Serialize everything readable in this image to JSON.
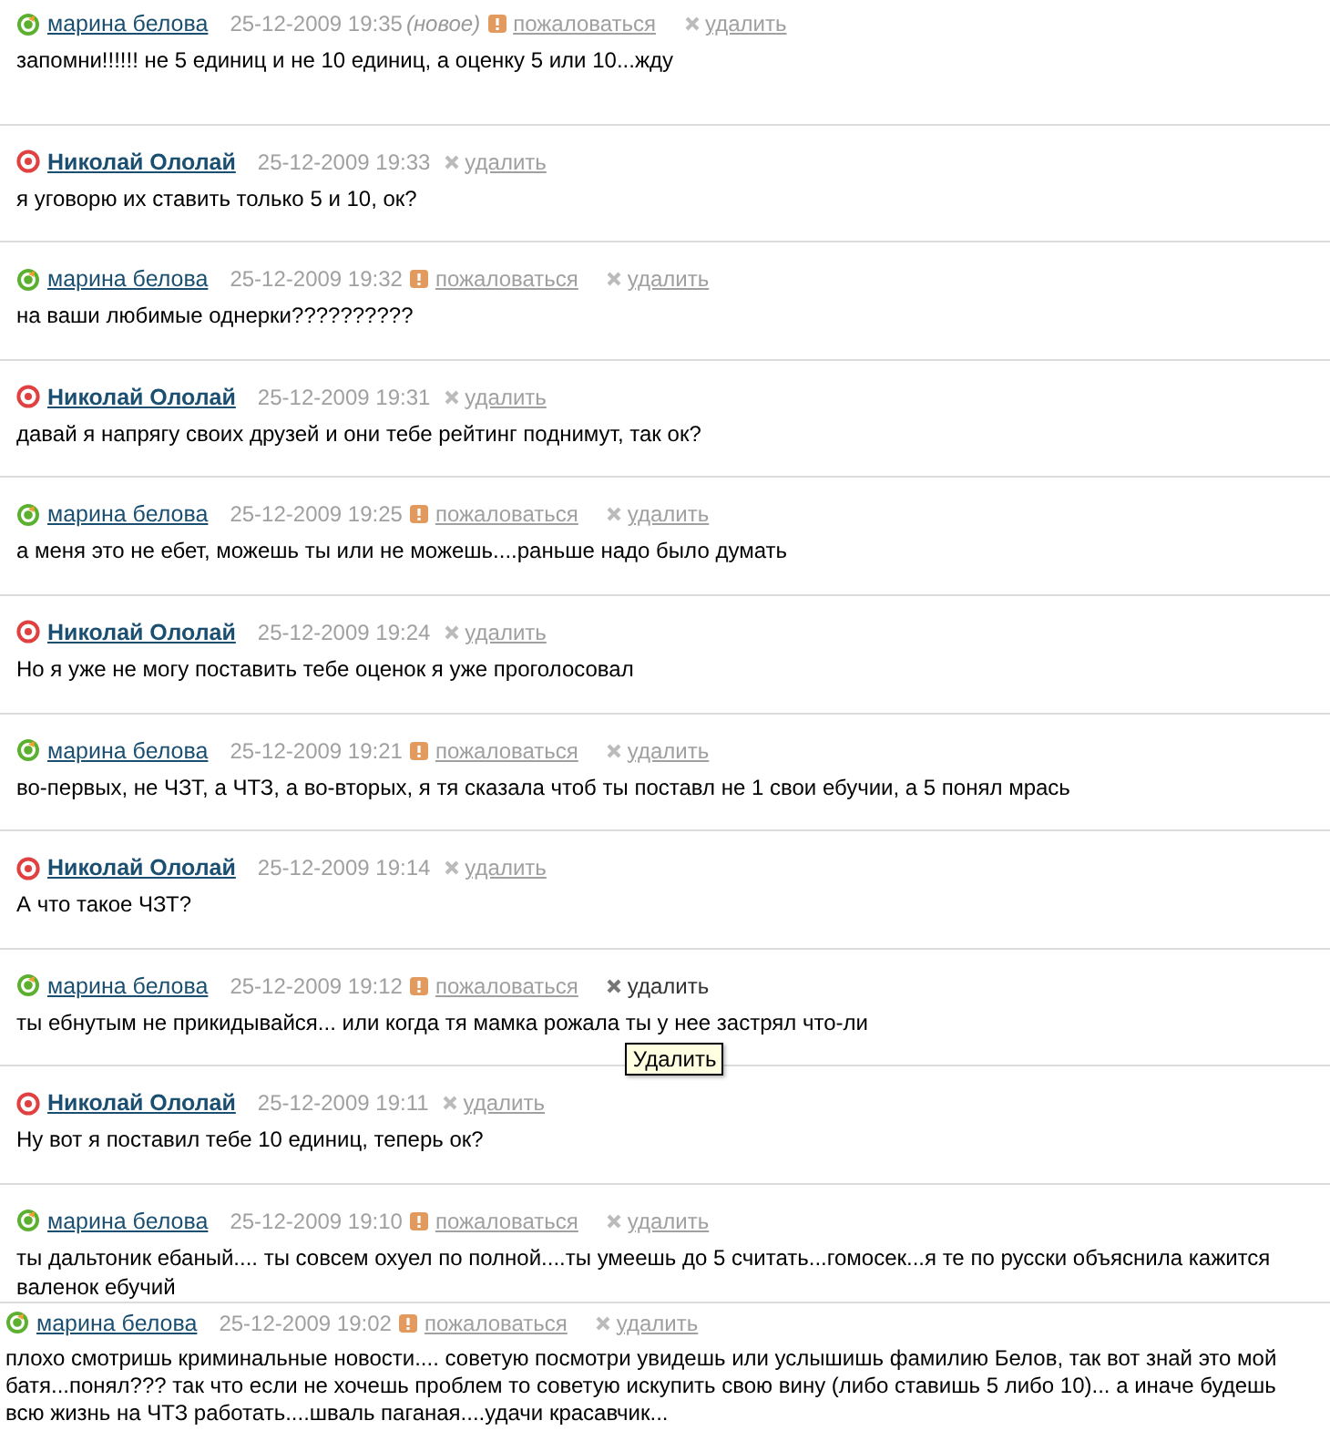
{
  "comments": [
    {
      "kind": "friend",
      "author": "марина белова",
      "time": "25-12-2009 19:35",
      "new_label": "(новое)",
      "report": "пожаловаться",
      "delete": "удалить",
      "hovered": false,
      "root": false,
      "text": "запомни!!!!!! не 5 единиц и не 10 единиц, а оценку 5 или 10...жду"
    },
    {
      "kind": "owner",
      "author": "Николай Ололай",
      "time": "25-12-2009 19:33",
      "delete": "удалить",
      "hovered": false,
      "root": false,
      "text": "я уговорю их ставить только 5 и 10, ок?"
    },
    {
      "kind": "friend",
      "author": "марина белова",
      "time": "25-12-2009 19:32",
      "report": "пожаловаться",
      "delete": "удалить",
      "hovered": false,
      "root": false,
      "text": "на ваши любимые однерки??????????"
    },
    {
      "kind": "owner",
      "author": "Николай Ололай",
      "time": "25-12-2009 19:31",
      "delete": "удалить",
      "hovered": false,
      "root": false,
      "text": "давай я напрягу своих друзей и они тебе рейтинг поднимут, так ок?"
    },
    {
      "kind": "friend",
      "author": "марина белова",
      "time": "25-12-2009 19:25",
      "report": "пожаловаться",
      "delete": "удалить",
      "hovered": false,
      "root": false,
      "text": "а меня это не ебет, можешь ты или не можешь....раньше надо было думать"
    },
    {
      "kind": "owner",
      "author": "Николай Ололай",
      "time": "25-12-2009 19:24",
      "delete": "удалить",
      "hovered": false,
      "root": false,
      "text": "Но я уже не могу поставить тебе оценок я уже проголосовал"
    },
    {
      "kind": "friend",
      "author": "марина белова",
      "time": "25-12-2009 19:21",
      "report": "пожаловаться",
      "delete": "удалить",
      "hovered": false,
      "root": false,
      "text": "во-первых, не ЧЗТ, а ЧТЗ, а во-вторых, я тя сказала чтоб ты поставл не 1 свои ебучии, а 5 понял мрась"
    },
    {
      "kind": "owner",
      "author": "Николай Ололай",
      "time": "25-12-2009 19:14",
      "delete": "удалить",
      "hovered": false,
      "root": false,
      "text": "А что такое ЧЗТ?"
    },
    {
      "kind": "friend",
      "author": "марина белова",
      "time": "25-12-2009 19:12",
      "report": "пожаловаться",
      "delete": "удалить",
      "hovered": true,
      "tooltip": "Удалить",
      "root": false,
      "text": "ты ебнутым не прикидывайся... или когда тя мамка рожала ты у нее застрял что-ли"
    },
    {
      "kind": "owner",
      "author": "Николай Ололай",
      "time": "25-12-2009 19:11",
      "delete": "удалить",
      "hovered": false,
      "root": false,
      "text": "Ну вот я поставил тебе 10 единиц, теперь ок?"
    },
    {
      "kind": "friend",
      "author": "марина белова",
      "time": "25-12-2009 19:10",
      "report": "пожаловаться",
      "delete": "удалить",
      "hovered": false,
      "root": false,
      "text": "ты дальтоник ебаный.... ты совсем охуел по полной....ты умеешь до 5 считать...гомосек...я те по русски объяснила кажится валенок ебучий"
    },
    {
      "kind": "friend",
      "author": "марина белова",
      "time": "25-12-2009 19:02",
      "report": "пожаловаться",
      "delete": "удалить",
      "hovered": false,
      "root": true,
      "text": "плохо смотришь криминальные новости.... советую посмотри увидешь или услышишь фамилию Белов, так вот знай это мой батя...понял??? так что если не хочешь проблем то советую искупить свою вину (либо ставишь 5 либо 10)... а иначе будешь всю жизнь на ЧТЗ работать....шваль паганая....удачи красавчик..."
    }
  ]
}
